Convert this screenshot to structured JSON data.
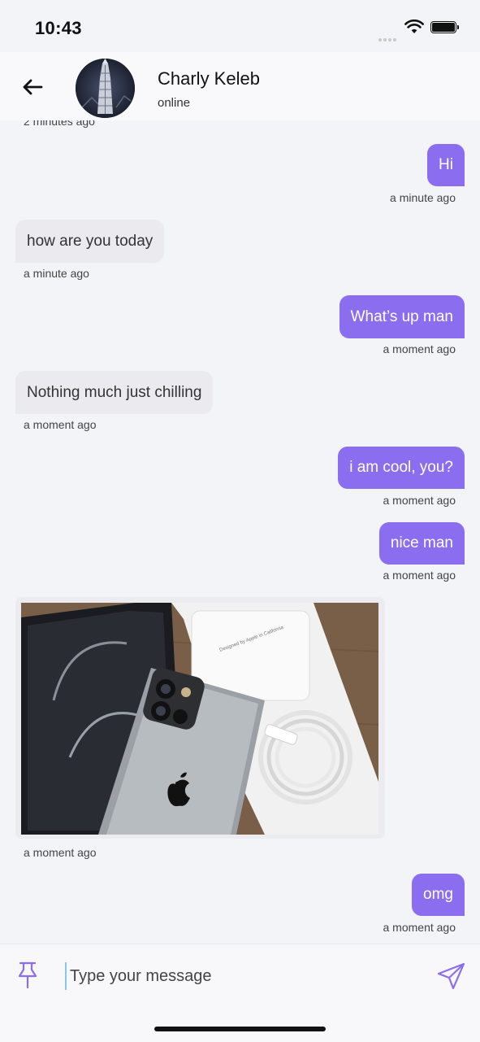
{
  "status_bar": {
    "time": "10:43"
  },
  "header": {
    "contact_name": "Charly Keleb",
    "contact_status": "online"
  },
  "messages": [
    {
      "direction": "in",
      "type": "timestamp",
      "time": "2 minutes ago"
    },
    {
      "direction": "out",
      "text": "Hi",
      "time": "a minute ago"
    },
    {
      "direction": "in",
      "text": "how are you today",
      "time": "a minute ago"
    },
    {
      "direction": "out",
      "text": "What’s up man",
      "time": "a moment ago"
    },
    {
      "direction": "in",
      "text": "Nothing much just chilling",
      "time": "a moment ago"
    },
    {
      "direction": "out",
      "text": "i am cool, you?",
      "time": "a moment ago"
    },
    {
      "direction": "out",
      "text": "nice man",
      "time": "a moment ago"
    },
    {
      "direction": "in",
      "type": "image",
      "image_caption": "Designed by Apple in California",
      "time": "a moment ago"
    },
    {
      "direction": "out",
      "text": "omg",
      "time": "a moment ago"
    }
  ],
  "composer": {
    "placeholder": "Type your message"
  },
  "icons": {
    "back": "arrow-left-icon",
    "attach": "pin-icon",
    "send": "send-icon"
  },
  "colors": {
    "accent": "#8b6df0",
    "incoming_bubble": "#ebebef",
    "background": "#f3f4f8"
  }
}
